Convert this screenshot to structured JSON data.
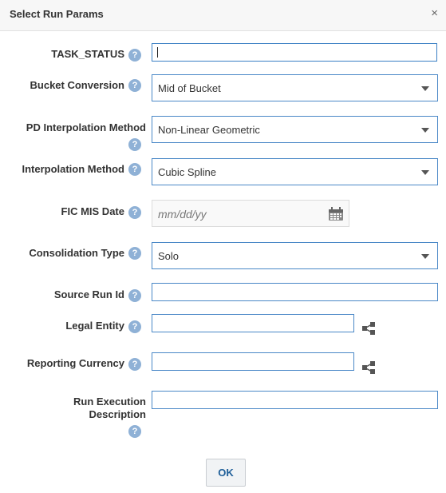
{
  "dialog": {
    "title": "Select Run Params",
    "close_glyph": "×"
  },
  "help_glyph": "?",
  "fields": {
    "task_status": {
      "label": "TASK_STATUS",
      "value": ""
    },
    "bucket_conversion": {
      "label": "Bucket Conversion",
      "value": "Mid of Bucket"
    },
    "pd_interpolation": {
      "label": "PD Interpolation Method",
      "value": "Non-Linear Geometric"
    },
    "interpolation": {
      "label": "Interpolation Method",
      "value": "Cubic Spline"
    },
    "fic_mis_date": {
      "label": "FIC MIS Date",
      "placeholder": "mm/dd/yy"
    },
    "consolidation_type": {
      "label": "Consolidation Type",
      "value": "Solo"
    },
    "source_run_id": {
      "label": "Source Run Id",
      "value": ""
    },
    "legal_entity": {
      "label": "Legal Entity",
      "value": ""
    },
    "reporting_currency": {
      "label": "Reporting Currency",
      "value": ""
    },
    "run_execution_description": {
      "label": "Run Execution Description",
      "value": ""
    }
  },
  "buttons": {
    "ok": "OK"
  },
  "icons": {
    "help": "help-icon",
    "calendar": "calendar-icon",
    "hierarchy": "hierarchy-icon",
    "dropdown": "chevron-down-icon"
  },
  "colors": {
    "accent": "#4a88c7",
    "help": "#8fb1d6",
    "ok_text": "#1f5f99"
  }
}
